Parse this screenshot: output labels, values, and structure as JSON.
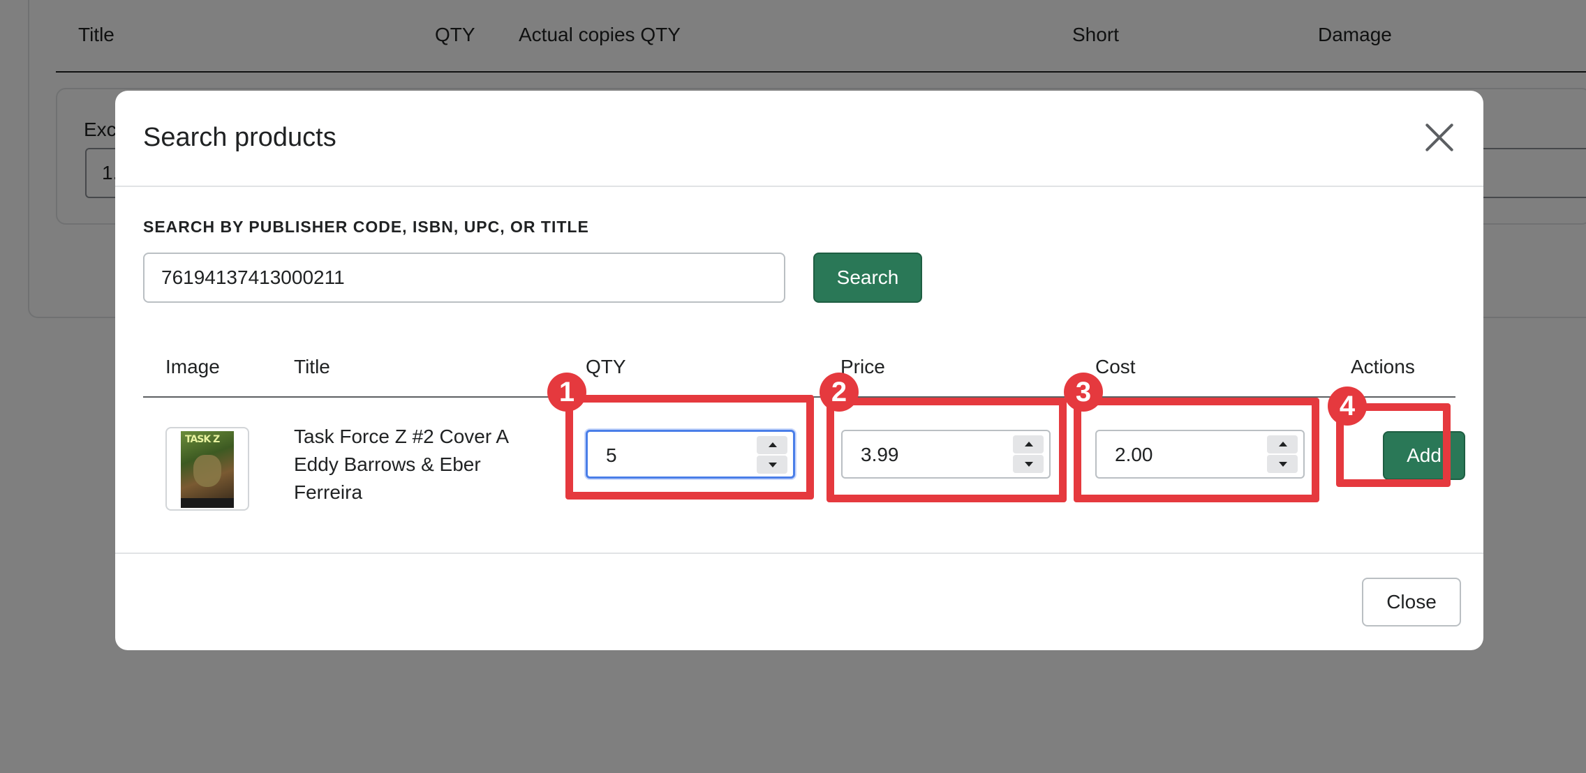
{
  "background": {
    "columns": [
      "Title",
      "QTY",
      "Actual copies QTY",
      "Short",
      "Damage"
    ],
    "subcard_label": "Exc",
    "subcard_input_value": "1."
  },
  "modal": {
    "title": "Search products",
    "search_label": "SEARCH BY PUBLISHER CODE, ISBN, UPC, OR TITLE",
    "search_value": "76194137413000211",
    "search_button": "Search",
    "table_headers": {
      "image": "Image",
      "title": "Title",
      "qty": "QTY",
      "price": "Price",
      "cost": "Cost",
      "actions": "Actions"
    },
    "row": {
      "cover_text": "TASK Z",
      "title": "Task Force Z #2 Cover A Eddy Barrows & Eber Ferreira",
      "qty": "5",
      "price": "3.99",
      "cost": "2.00",
      "add_button": "Add"
    },
    "close_button": "Close"
  },
  "annotations": [
    "1",
    "2",
    "3",
    "4"
  ],
  "colors": {
    "primary": "#2a7857",
    "highlight": "#e5393e",
    "focus": "#4a7ee8"
  }
}
